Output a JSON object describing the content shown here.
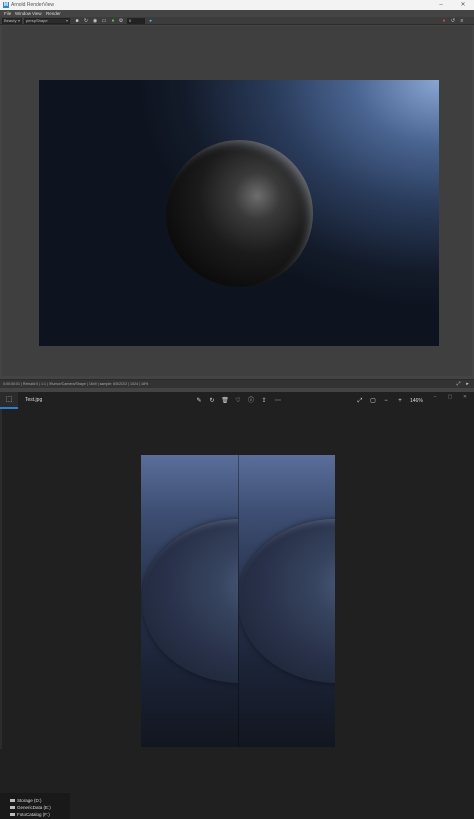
{
  "render_view": {
    "title": "Arnold RenderView",
    "menus": [
      "File",
      "Window",
      "View",
      "Render"
    ],
    "toolbar": {
      "camera": "Beauty",
      "aov": "perspShape",
      "exposure": "0"
    },
    "status": "0:00:00:01 | Rebuild:0 | 1:1 | /Rumor/Camera/Shape | 16x9 | sample: 6/5/2/2/2 | 1024 | 18%"
  },
  "photos": {
    "file_name": "Test.jpg",
    "zoom": "146%",
    "drives": [
      "Storage (D:)",
      "GenericData (E:)",
      "FotoCatalog (F:)"
    ]
  },
  "colors": {
    "accent": "#2c7fd0",
    "render_bg": "#3f3f3f",
    "photos_bg": "#202020"
  },
  "icons": {
    "render_view": [
      "arnold-logo-icon",
      "minimize-icon",
      "close-icon",
      "stop-icon",
      "refresh-icon",
      "camera-icon",
      "crop-icon",
      "settings-icon"
    ],
    "photos": [
      "photos-app-icon",
      "edit-icon",
      "rotate-icon",
      "delete-icon",
      "favorite-icon",
      "info-icon",
      "share-icon",
      "more-icon",
      "fullscreen-icon",
      "fit-icon",
      "zoom-out-icon",
      "zoom-in-icon"
    ]
  }
}
